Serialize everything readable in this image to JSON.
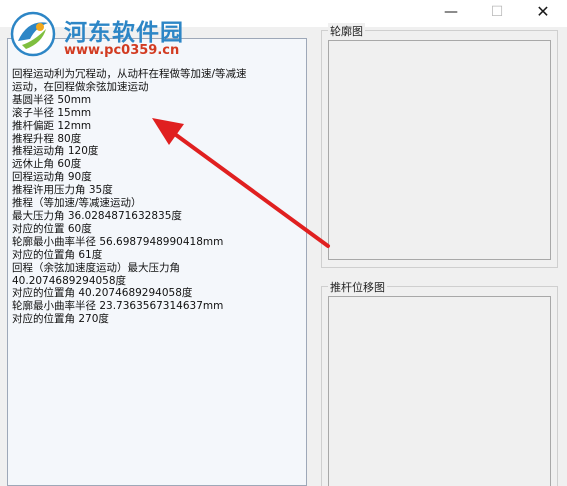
{
  "window": {
    "minimize_glyph": "—",
    "maximize_glyph": "☐",
    "close_glyph": "✕"
  },
  "watermark": {
    "site_name": "河东软件园",
    "url": "www.pc0359.cn"
  },
  "results": {
    "lines": [
      "回程运动利为冗程动，从动杆在程做等加速/等减速",
      "运动，在回程做余弦加速运动",
      "基圆半径   50mm",
      "滚子半径   15mm",
      "推杆偏距   12mm",
      "推程升程   80度",
      "推程运动角 120度",
      "远休止角   60度",
      "回程运动角 90度",
      "推程许用压力角 35度",
      "推程（等加速/等减速运动）",
      "最大压力角    36.0284871632835度",
      "对应的位置    60度",
      "轮廓最小曲率半径  56.6987948990418mm",
      "对应的位置角  61度",
      " 回程（余弦加速度运动）最大压力角",
      "40.2074689294058度",
      "对应的位置角  40.2074689294058度",
      "轮廓最小曲率半径  23.7363567314637mm",
      "对应的位置角  270度"
    ]
  },
  "panels": {
    "profile_title": "轮廓图",
    "displacement_title": "推杆位移图"
  },
  "colors": {
    "annotation_arrow": "#e02020",
    "watermark_blue": "#2d86c6",
    "watermark_red": "#d23b21"
  }
}
